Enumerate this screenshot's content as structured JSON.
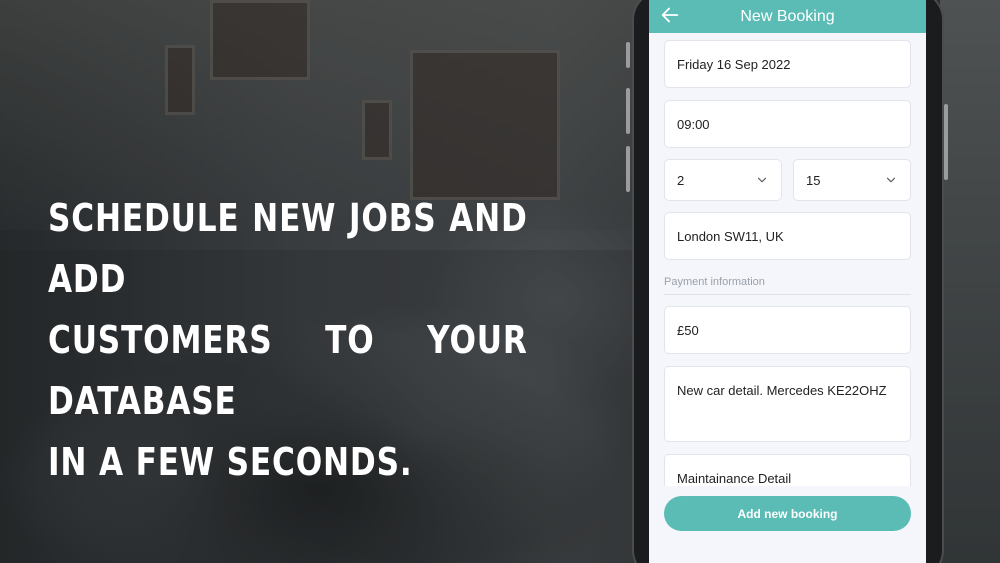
{
  "headline": {
    "line1": "Schedule new jobs and add",
    "line2": "customers to your database",
    "line3": "in a few seconds."
  },
  "app": {
    "title": "New Booking",
    "accent_color": "#5bbcb6",
    "back_icon": "arrow-left-icon"
  },
  "form": {
    "date_value": "Friday 16 Sep 2022",
    "time_value": "09:00",
    "hours_value": "2",
    "minutes_value": "15",
    "location_value": "London SW11, UK",
    "payment_section_label": "Payment information",
    "price_value": "£50",
    "notes_value": "New car detail. Mercedes KE22OHZ",
    "service_value": "Maintainance Detail",
    "submit_label": "Add new booking"
  }
}
